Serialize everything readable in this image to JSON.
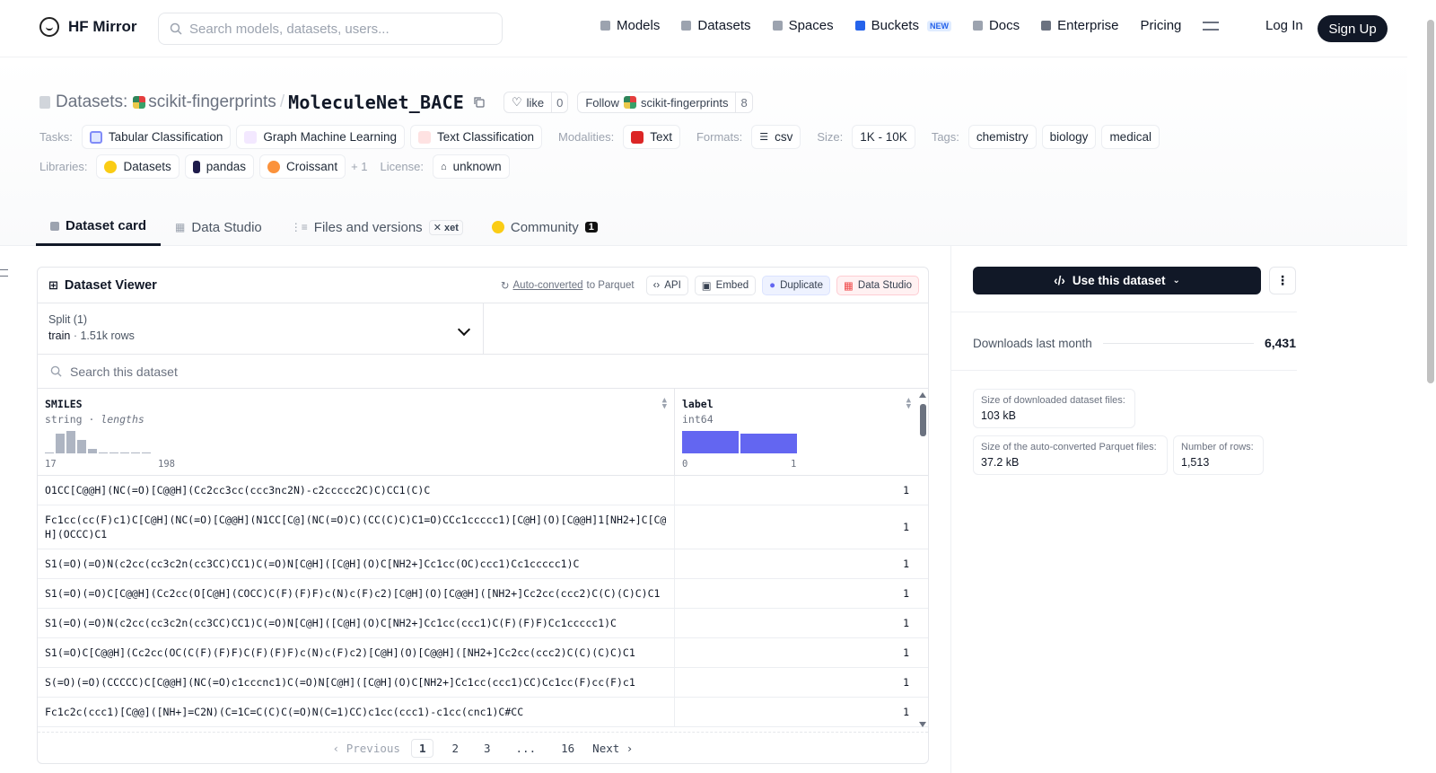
{
  "nav": {
    "brand": "HF Mirror",
    "search_placeholder": "Search models, datasets, users...",
    "links": [
      {
        "label": "Models",
        "color": "#9ca3af"
      },
      {
        "label": "Datasets",
        "color": "#9ca3af"
      },
      {
        "label": "Spaces",
        "color": "#9ca3af"
      },
      {
        "label": "Buckets",
        "color": "#2563eb",
        "badge": "NEW"
      },
      {
        "label": "Docs",
        "color": "#9ca3af"
      },
      {
        "label": "Enterprise",
        "color": "#6b7280"
      },
      {
        "label": "Pricing"
      }
    ],
    "login": "Log In",
    "signup": "Sign Up"
  },
  "header": {
    "prefix": "Datasets:",
    "org": "scikit-fingerprints",
    "sep": "/",
    "name": "MoleculeNet_BACE",
    "like_label": "like",
    "like_count": "0",
    "follow_label": "Follow",
    "follow_org": "scikit-fingerprints",
    "follow_count": "8"
  },
  "tags": {
    "tasks_key": "Tasks:",
    "tasks": [
      {
        "label": "Tabular Classification",
        "color": "#818cf8"
      },
      {
        "label": "Graph Machine Learning",
        "color": "#c084fc"
      },
      {
        "label": "Text Classification",
        "color": "#f87171"
      }
    ],
    "modalities_key": "Modalities:",
    "modalities": [
      {
        "label": "Text",
        "color": "#dc2626"
      }
    ],
    "formats_key": "Formats:",
    "formats": [
      {
        "label": "csv"
      }
    ],
    "size_key": "Size:",
    "size": "1K - 10K",
    "tags_key": "Tags:",
    "tag_list": [
      "chemistry",
      "biology",
      "medical"
    ],
    "libraries_key": "Libraries:",
    "libraries": [
      {
        "label": "Datasets",
        "color": "#facc15"
      },
      {
        "label": "pandas",
        "color": "#1e1b4b"
      },
      {
        "label": "Croissant",
        "color": "#fb923c"
      }
    ],
    "libraries_more": "+ 1",
    "license_key": "License:",
    "license": "unknown"
  },
  "tabs": [
    {
      "label": "Dataset card",
      "active": true
    },
    {
      "label": "Data Studio"
    },
    {
      "label": "Files and versions",
      "badge": "xet"
    },
    {
      "label": "Community",
      "count": "1"
    }
  ],
  "viewer": {
    "title": "Dataset Viewer",
    "auto_converted": "Auto-converted",
    "to_parquet": " to Parquet",
    "api": "API",
    "embed": "Embed",
    "duplicate": "Duplicate",
    "data_studio": "Data Studio",
    "split_label": "Split (1)",
    "split_name": "train",
    "split_rows": "1.51k rows",
    "search_placeholder": "Search this dataset",
    "columns": [
      {
        "name": "SMILES",
        "type": "string",
        "extra": "lengths",
        "min": "17",
        "max": "198"
      },
      {
        "name": "label",
        "type": "int64",
        "min": "0",
        "max": "1"
      }
    ],
    "smiles_hist": [
      1,
      22,
      25,
      15,
      5,
      1,
      1,
      1,
      1,
      1
    ],
    "label_hist": [
      0.53,
      0.47
    ],
    "rows": [
      {
        "smiles": "O1CC[C@@H](NC(=O)[C@@H](Cc2cc3cc(ccc3nc2N)-c2ccccc2C)C)CC1(C)C",
        "label": "1"
      },
      {
        "smiles": "Fc1cc(cc(F)c1)C[C@H](NC(=O)[C@@H](N1CC[C@](NC(=O)C)(CC(C)C)C1=O)CCc1ccccc1)[C@H](O)[C@@H]1[NH2+]C[C@H](OCCC)C1",
        "label": "1"
      },
      {
        "smiles": "S1(=O)(=O)N(c2cc(cc3c2n(cc3CC)CC1)C(=O)N[C@H]([C@H](O)C[NH2+]Cc1cc(OC)ccc1)Cc1ccccc1)C",
        "label": "1"
      },
      {
        "smiles": "S1(=O)(=O)C[C@@H](Cc2cc(O[C@H](COCC)C(F)(F)F)c(N)c(F)c2)[C@H](O)[C@@H]([NH2+]Cc2cc(ccc2)C(C)(C)C)C1",
        "label": "1"
      },
      {
        "smiles": "S1(=O)(=O)N(c2cc(cc3c2n(cc3CC)CC1)C(=O)N[C@H]([C@H](O)C[NH2+]Cc1cc(ccc1)C(F)(F)F)Cc1ccccc1)C",
        "label": "1"
      },
      {
        "smiles": "S1(=O)C[C@@H](Cc2cc(OC(C(F)(F)F)C(F)(F)F)c(N)c(F)c2)[C@H](O)[C@@H]([NH2+]Cc2cc(ccc2)C(C)(C)C)C1",
        "label": "1"
      },
      {
        "smiles": "S(=O)(=O)(CCCCC)C[C@@H](NC(=O)c1cccnc1)C(=O)N[C@H]([C@H](O)C[NH2+]Cc1cc(ccc1)CC)Cc1cc(F)cc(F)c1",
        "label": "1"
      },
      {
        "smiles": "Fc1c2c(ccc1)[C@@]([NH+]=C2N)(C=1C=C(C)C(=O)N(C=1)CC)c1cc(ccc1)-c1cc(cnc1)C#CC",
        "label": "1"
      }
    ],
    "pager": {
      "prev": "Previous",
      "pages": [
        "1",
        "2",
        "3",
        "...",
        "16"
      ],
      "next": "Next",
      "current": "1"
    }
  },
  "sidebar": {
    "use_label": "Use this dataset",
    "downloads_label": "Downloads last month",
    "downloads_value": "6,431",
    "stats": [
      {
        "k": "Size of downloaded dataset files:",
        "v": "103 kB"
      },
      {
        "k": "Size of the auto-converted Parquet files:",
        "v": "37.2 kB"
      },
      {
        "k": "Number of rows:",
        "v": "1,513"
      }
    ]
  }
}
